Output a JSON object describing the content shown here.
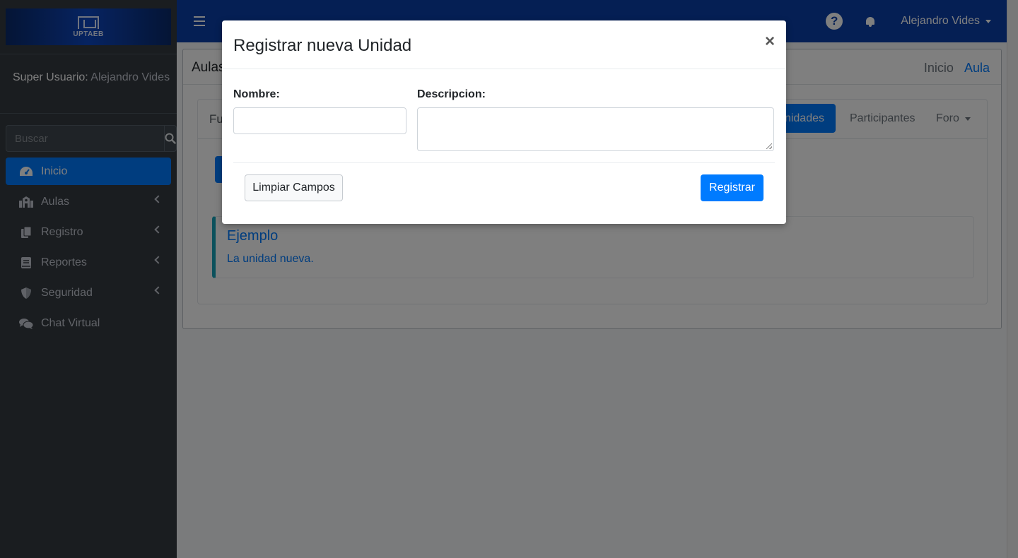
{
  "sidebar": {
    "logo_text": "UPTAEB",
    "user_role": "Super Usuario:",
    "user_name": "Alejandro Vides",
    "search_placeholder": "Buscar",
    "items": [
      {
        "label": "Inicio",
        "icon": "dashboard-icon",
        "active": true
      },
      {
        "label": "Aulas",
        "icon": "school-icon"
      },
      {
        "label": "Registro",
        "icon": "copy-icon"
      },
      {
        "label": "Reportes",
        "icon": "book-icon"
      },
      {
        "label": "Seguridad",
        "icon": "shield-icon"
      },
      {
        "label": "Chat Virtual",
        "icon": "comments-icon"
      }
    ]
  },
  "topbar": {
    "help_glyph": "?",
    "user_menu": "Alejandro Vides"
  },
  "content": {
    "card_title": "Aulas",
    "breadcrumb": {
      "home": "Inicio",
      "current": "Aula"
    },
    "tabs": {
      "first": "Fu",
      "unidades": "nidades",
      "participantes": "Participantes",
      "foro": "Foro"
    },
    "unit": {
      "title": "Ejemplo",
      "description": "La unidad nueva."
    }
  },
  "modal": {
    "title": "Registrar nueva Unidad",
    "close": "×",
    "nombre_label": "Nombre:",
    "nombre_value": "",
    "descripcion_label": "Descripcion:",
    "descripcion_value": "",
    "clear_button": "Limpiar Campos",
    "submit_button": "Registrar"
  },
  "colors": {
    "primary": "#007bff",
    "navbar": "#0b3ea8",
    "sidebar": "#343a40",
    "callout_border": "#17a2b8"
  }
}
